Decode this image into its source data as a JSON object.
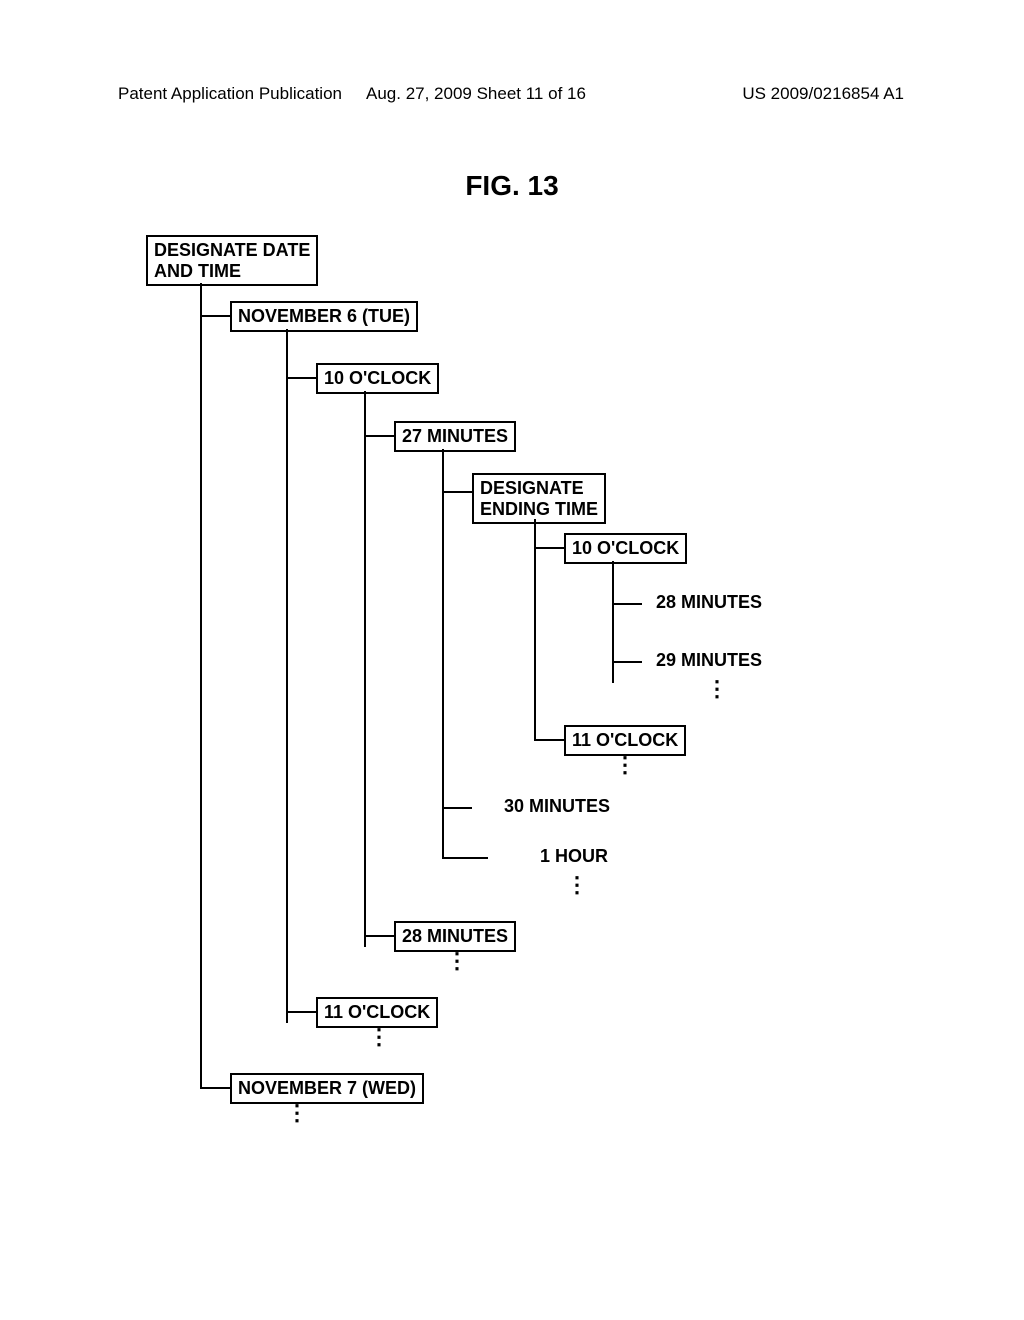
{
  "header": {
    "left": "Patent Application Publication",
    "mid": "Aug. 27, 2009  Sheet 11 of 16",
    "right": "US 2009/0216854 A1"
  },
  "figure_title": "FIG. 13",
  "nodes": {
    "root": "DESIGNATE DATE\nAND TIME",
    "date1": "NOVEMBER 6 (TUE)",
    "hour10_a": "10 O'CLOCK",
    "min27": "27 MINUTES",
    "designate_end": "DESIGNATE\nENDING TIME",
    "hour10_b": "10 O'CLOCK",
    "min28_p": "28 MINUTES",
    "min29_p": "29 MINUTES",
    "hour11_b": "11 O'CLOCK",
    "min30_p": "30 MINUTES",
    "hour1_p": "1 HOUR",
    "min28_box": "28 MINUTES",
    "hour11_a": "11 O'CLOCK",
    "date2": "NOVEMBER 7 (WED)"
  }
}
